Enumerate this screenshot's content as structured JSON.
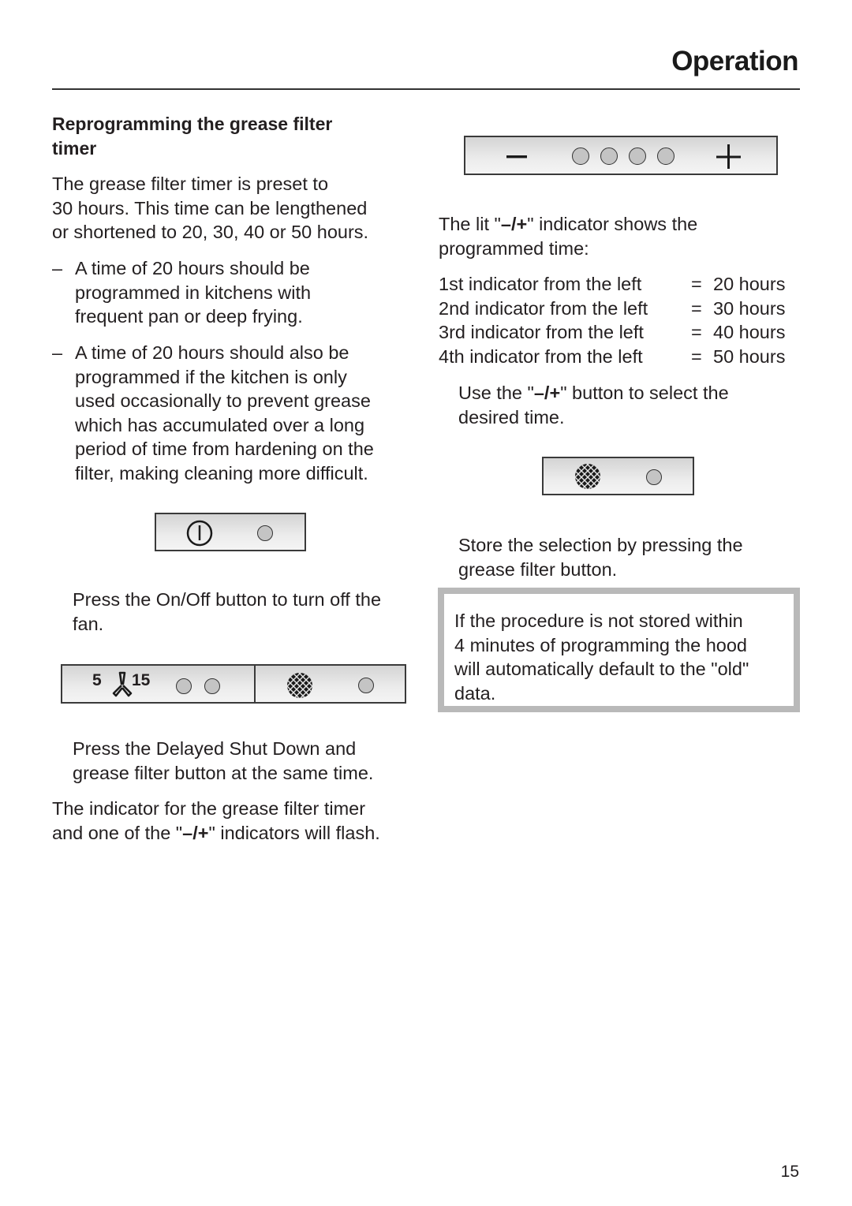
{
  "header": {
    "section_title": "Operation"
  },
  "left_column": {
    "heading_line1": "Reprogramming the grease filter",
    "heading_line2": "timer",
    "intro": [
      "The grease filter timer is preset to",
      "30 hours. This time can be lengthened",
      "or shortened to 20, 30, 40 or 50 hours."
    ],
    "bullets": [
      {
        "dash": "–",
        "lines": [
          "A time of 20 hours should be",
          "programmed in kitchens with",
          "frequent pan or deep frying."
        ]
      },
      {
        "dash": "–",
        "lines": [
          "A time of 20 hours should also be",
          "programmed if the kitchen is only",
          "used occasionally to prevent grease",
          "which has accumulated over a long",
          "period of time from hardening on the",
          "filter, making cleaning more difficult."
        ]
      }
    ],
    "onoff_panel": {
      "icons": [
        "power-icon",
        "indicator-light"
      ]
    },
    "step_turn_off": [
      "Press the On/Off button to turn off the",
      "fan."
    ],
    "delay_panel": {
      "delay_left_number": "5",
      "delay_right_number": "15",
      "icons": [
        "fan-icon",
        "indicator-light",
        "indicator-light",
        "grease-filter-icon",
        "indicator-light"
      ]
    },
    "step_press_both": [
      "Press the Delayed Shut Down and",
      "grease filter button at the same time."
    ],
    "flash_text": {
      "line1": "The indicator for the grease filter timer",
      "line2_before": "and one of the \"",
      "line2_bold": "–/+",
      "line2_after": "\" indicators will flash."
    }
  },
  "right_column": {
    "minus_plus_panel": {
      "minus_symbol": "−",
      "plus_symbol": "+",
      "indicator_count": 4
    },
    "lit_text": {
      "line1_before": "The lit \"",
      "line1_bold": "–/+",
      "line1_after": "\" indicator shows the",
      "line2": "programmed time:"
    },
    "indicator_table": [
      {
        "label": "1st indicator from the left",
        "eq": "=",
        "value": "20 hours"
      },
      {
        "label": "2nd indicator from the left",
        "eq": "=",
        "value": "30 hours"
      },
      {
        "label": "3rd indicator from the left",
        "eq": "=",
        "value": "40 hours"
      },
      {
        "label": "4th indicator from the left",
        "eq": "=",
        "value": "50 hours"
      }
    ],
    "use_button_text": {
      "line1_before": "Use the \"",
      "line1_bold": "–/+",
      "line1_after": "\" button to select the",
      "line2": "desired time."
    },
    "filter_panel": {
      "icons": [
        "grease-filter-icon",
        "indicator-light"
      ]
    },
    "store_text": [
      "Store the selection by pressing the",
      "grease filter button."
    ],
    "note_box": [
      "If the procedure is not stored within",
      "4 minutes of programming the hood",
      "will automatically default to the \"old\"",
      "data."
    ]
  },
  "footer": {
    "page_number": "15"
  }
}
